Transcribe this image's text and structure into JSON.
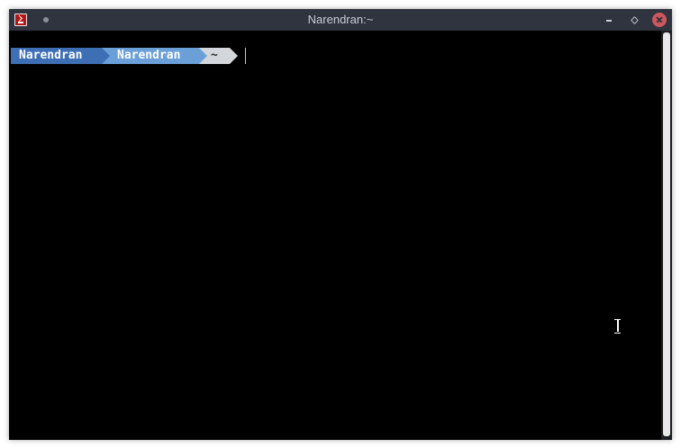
{
  "window": {
    "title": "Narendran:~"
  },
  "titlebar": {
    "icons": {
      "app": "terminal-icon",
      "pin": "dot-icon",
      "minimize": "minimize-icon",
      "maximize": "restore-icon",
      "close": "close-icon"
    },
    "close_color": "#cc575d",
    "background": "#2f343f"
  },
  "terminal": {
    "prompt": {
      "user": "Narendran",
      "host": "Narendran",
      "dir": "~"
    },
    "colors": {
      "user_bg": "#3e6fb5",
      "host_bg": "#6a9fd8",
      "dir_bg": "#d3d6db",
      "background": "#000000"
    },
    "pointer_icon": "ibeam-cursor-icon"
  }
}
